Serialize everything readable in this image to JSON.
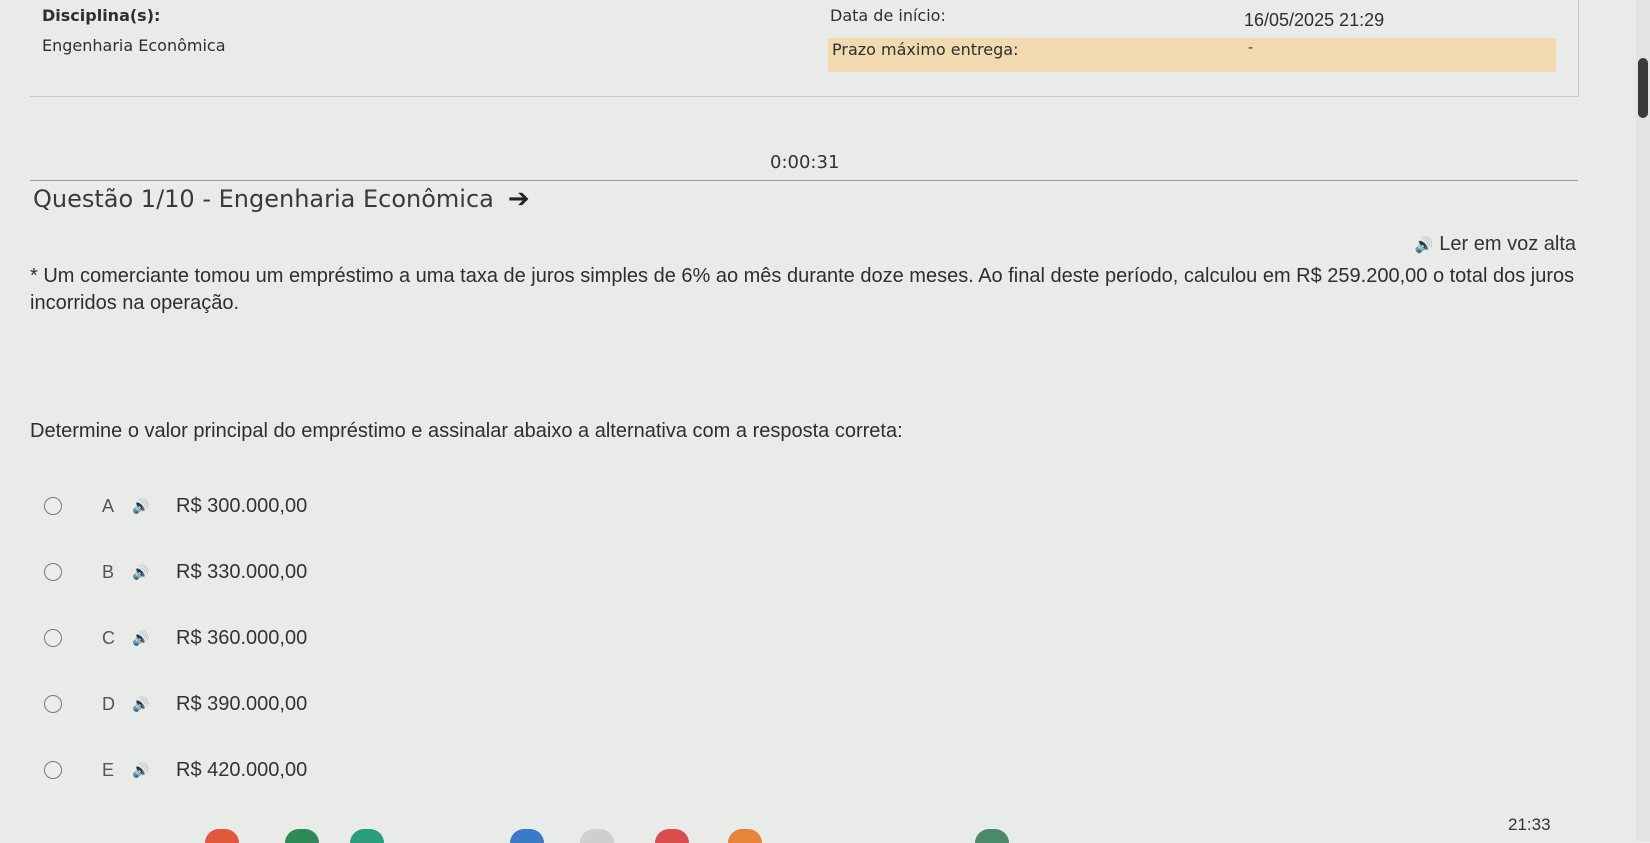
{
  "header": {
    "discipline_label": "Disciplina(s):",
    "discipline_value": "Engenharia Econômica",
    "start_date_label": "Data de início:",
    "start_date_value": "16/05/2025 21:29",
    "deadline_label": "Prazo máximo entrega:",
    "deadline_value": "-"
  },
  "timer": "0:00:31",
  "question": {
    "title": "Questão 1/10 - Engenharia Econômica",
    "read_aloud": "Ler em voz alta",
    "text": "* Um comerciante tomou um empréstimo a uma taxa de juros simples de 6% ao mês durante doze meses. Ao final deste período, calculou em R$ 259.200,00 o total dos juros incorridos na operação.",
    "instruction": "Determine o valor principal do empréstimo e assinalar abaixo a alternativa com a resposta correta:"
  },
  "options": [
    {
      "letter": "A",
      "value": "R$ 300.000,00"
    },
    {
      "letter": "B",
      "value": "R$ 330.000,00"
    },
    {
      "letter": "C",
      "value": "R$ 360.000,00"
    },
    {
      "letter": "D",
      "value": "R$ 390.000,00"
    },
    {
      "letter": "E",
      "value": "R$ 420.000,00"
    }
  ],
  "taskbar": {
    "clock": "21:33"
  },
  "colors": {
    "background": "#e9ebe8",
    "deadline_highlight": "#f1d9b0"
  }
}
